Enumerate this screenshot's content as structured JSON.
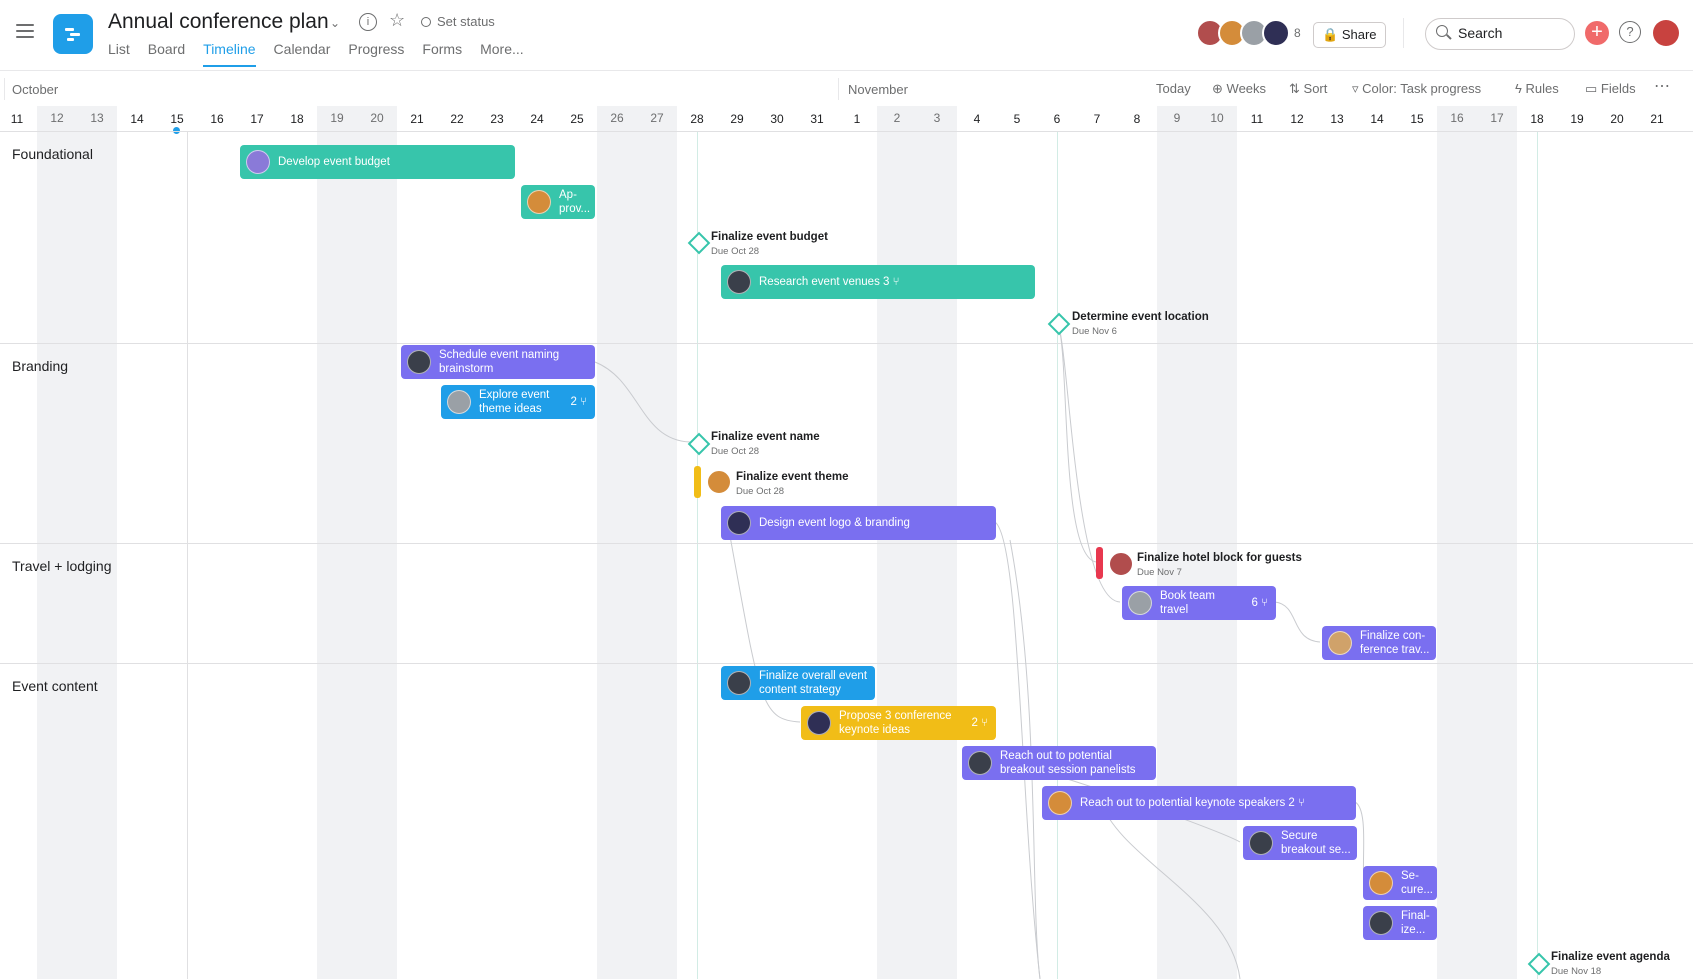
{
  "header": {
    "title": "Annual conference plan",
    "set_status": "Set status",
    "tabs": [
      {
        "label": "List",
        "active": false
      },
      {
        "label": "Board",
        "active": false
      },
      {
        "label": "Timeline",
        "active": true
      },
      {
        "label": "Calendar",
        "active": false
      },
      {
        "label": "Progress",
        "active": false
      },
      {
        "label": "Forms",
        "active": false
      },
      {
        "label": "More...",
        "active": false
      }
    ],
    "member_count": "8",
    "share_label": "Share",
    "search_placeholder": "Search",
    "accent_color": "#1f9ee8"
  },
  "toolbar": {
    "month_1": "October",
    "month_2": "November",
    "today": "Today",
    "weeks": "Weeks",
    "sort": "Sort",
    "color": "Color: Task progress",
    "rules": "Rules",
    "fields": "Fields"
  },
  "days": [
    "11",
    "12",
    "13",
    "14",
    "15",
    "16",
    "17",
    "18",
    "19",
    "20",
    "21",
    "22",
    "23",
    "24",
    "25",
    "26",
    "27",
    "28",
    "29",
    "30",
    "31",
    "1",
    "2",
    "3",
    "4",
    "5",
    "6",
    "7",
    "8",
    "9",
    "10",
    "11",
    "12",
    "13",
    "14",
    "15",
    "16",
    "17",
    "18",
    "19",
    "20",
    "21"
  ],
  "sections": [
    {
      "label": "Foundational"
    },
    {
      "label": "Branding"
    },
    {
      "label": "Travel + lodging"
    },
    {
      "label": "Event content"
    }
  ],
  "tasks": {
    "develop_budget": "Develop event budget",
    "approve": "Ap-\nprov...",
    "finalize_budget": "Finalize event budget",
    "finalize_budget_due": "Due Oct 28",
    "research_venues": "Research event venues",
    "research_venues_sub": "3",
    "determine_location": "Determine event location",
    "determine_location_due": "Due Nov 6",
    "schedule_naming": "Schedule event naming brainstorm",
    "explore_theme": "Explore event theme ideas",
    "explore_theme_sub": "2",
    "finalize_name": "Finalize event name",
    "finalize_name_due": "Due Oct 28",
    "finalize_theme": "Finalize event theme",
    "finalize_theme_due": "Due Oct 28",
    "design_logo": "Design event logo & branding",
    "hotel_block": "Finalize hotel block for guests",
    "hotel_block_due": "Due Nov 7",
    "book_travel": "Book team travel",
    "book_travel_sub": "6",
    "finalize_conf_travel": "Finalize con-\nference trav...",
    "content_strategy": "Finalize overall event content strategy",
    "propose_keynote": "Propose 3 conference keynote ideas",
    "propose_keynote_sub": "2",
    "reach_panelists": "Reach out to potential breakout session panelists",
    "reach_keynote": "Reach out to potential keynote speakers",
    "reach_keynote_sub": "2",
    "secure_breakout": "Secure breakout se...",
    "secure_2": "Se-\ncure...",
    "finalize_2": "Final-\nize...",
    "finalize_agenda": "Finalize event agenda",
    "finalize_agenda_due": "Due Nov 18"
  },
  "colors": {
    "green": "#37c5ab",
    "purple": "#7a6ff0",
    "blue": "#1f9ee8",
    "yellow": "#f1bd17",
    "red": "#e8384f"
  }
}
